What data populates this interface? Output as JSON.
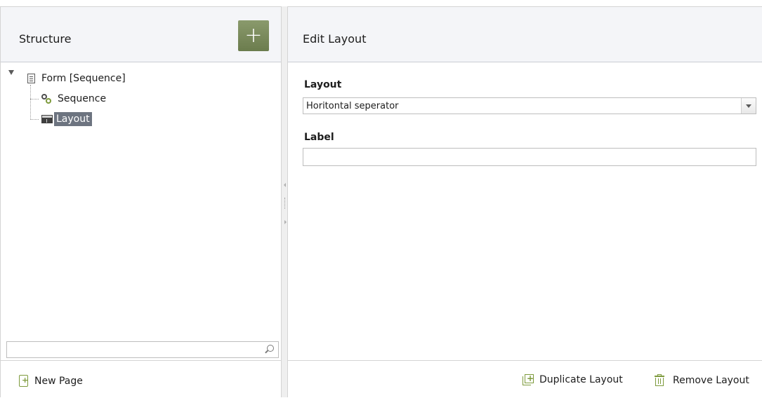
{
  "structure_panel": {
    "title": "Structure",
    "add_button_label": "+",
    "tree": [
      {
        "label": "Form [Sequence]",
        "icon": "form-icon",
        "expanded": true
      },
      {
        "label": "Sequence",
        "icon": "sequence-icon"
      },
      {
        "label": "Layout",
        "icon": "layout-icon",
        "selected": true
      }
    ],
    "search": {
      "value": "",
      "placeholder": ""
    },
    "new_page_label": "New Page"
  },
  "edit_panel": {
    "title": "Edit Layout",
    "layout_field": {
      "label": "Layout",
      "value": "Horitontal seperator"
    },
    "label_field": {
      "label": "Label",
      "value": ""
    },
    "duplicate_label": "Duplicate Layout",
    "remove_label": "Remove Layout"
  },
  "colors": {
    "accent_green": "#7d9a3c",
    "add_button": "#76875a",
    "selection": "#6d7480",
    "header_bg": "#f4f5f8"
  }
}
